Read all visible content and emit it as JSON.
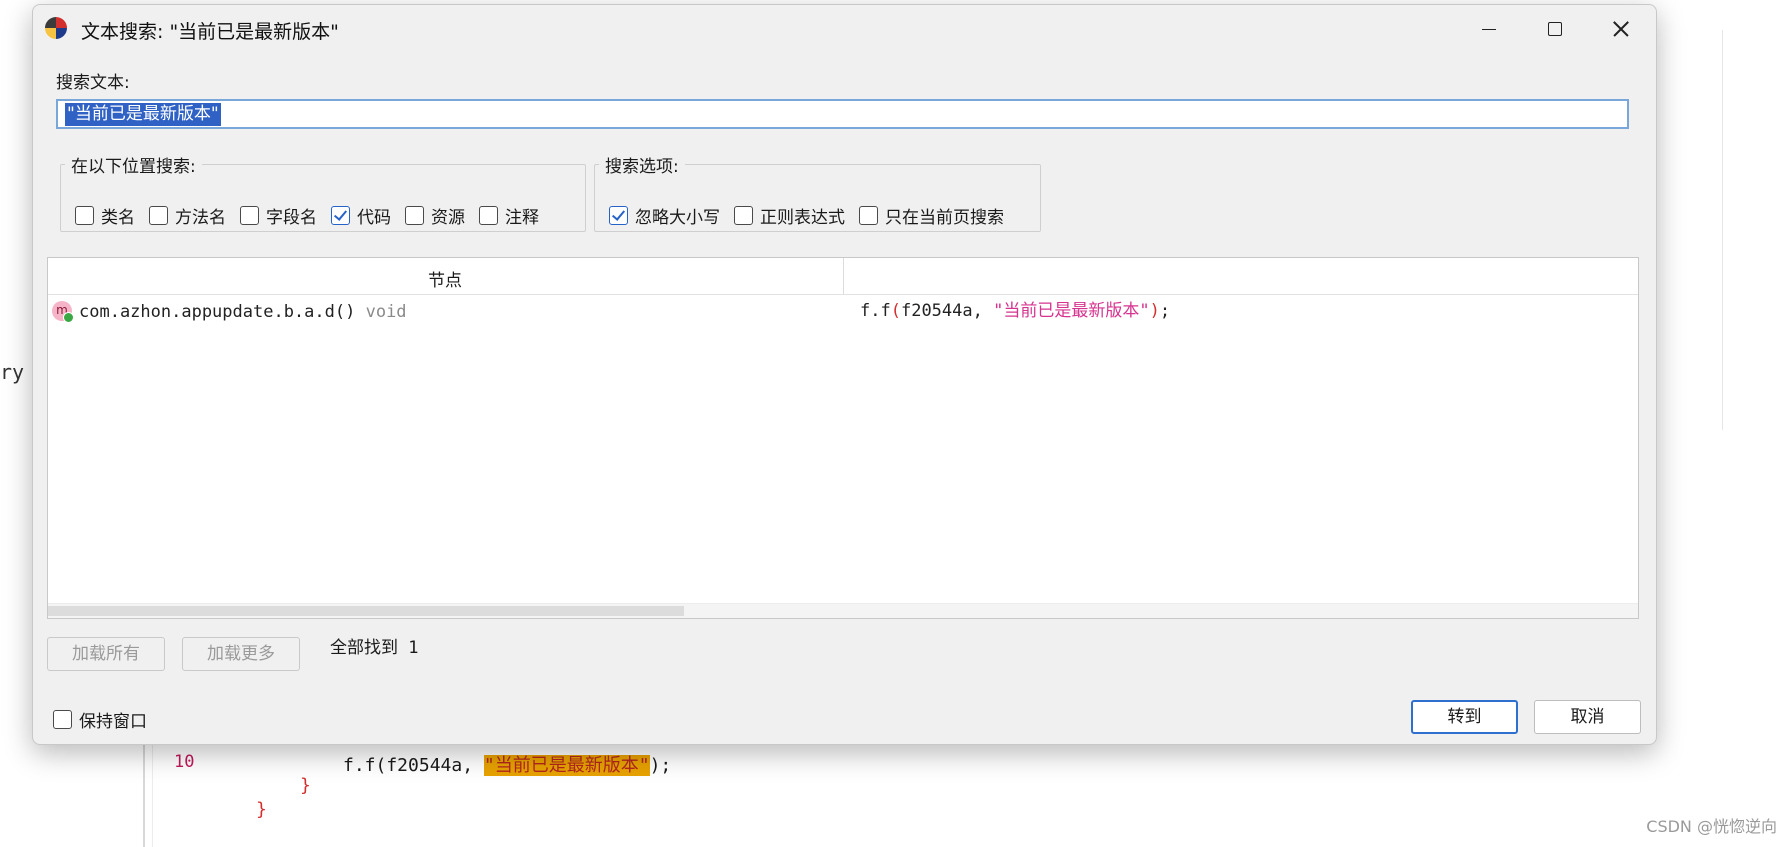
{
  "background": {
    "left_fragment": "ry",
    "line_number": "10",
    "code_prefix": "f.f(f20544a, ",
    "code_string": "\"当前已是最新版本\"",
    "code_suffix": ");",
    "brace_inner": "}",
    "brace_outer": "}",
    "watermark": "CSDN @恍惚逆向"
  },
  "dialog": {
    "title": "文本搜索: \"当前已是最新版本\"",
    "search_label": "搜索文本:",
    "search_value": "\"当前已是最新版本\"",
    "location_group": {
      "legend": "在以下位置搜索:",
      "options": [
        {
          "label": "类名",
          "checked": false
        },
        {
          "label": "方法名",
          "checked": false
        },
        {
          "label": "字段名",
          "checked": false
        },
        {
          "label": "代码",
          "checked": true
        },
        {
          "label": "资源",
          "checked": false
        },
        {
          "label": "注释",
          "checked": false
        }
      ]
    },
    "options_group": {
      "legend": "搜索选项:",
      "options": [
        {
          "label": "忽略大小写",
          "checked": true
        },
        {
          "label": "正则表达式",
          "checked": false
        },
        {
          "label": "只在当前页搜索",
          "checked": false
        }
      ]
    },
    "results": {
      "column_node": "节点",
      "rows": [
        {
          "icon_letter": "m",
          "node": "com.azhon.appupdate.b.a.d()",
          "return_type": "void",
          "code_prefix": "f.f",
          "code_open": "(",
          "code_args": "f20544a, ",
          "code_string": "\"当前已是最新版本\"",
          "code_close": ")",
          "code_end": ";"
        }
      ]
    },
    "load_all_label": "加载所有",
    "load_more_label": "加载更多",
    "found_text": "全部找到 1",
    "keep_window_label": "保持窗口",
    "keep_window_checked": false,
    "goto_label": "转到",
    "cancel_label": "取消"
  }
}
